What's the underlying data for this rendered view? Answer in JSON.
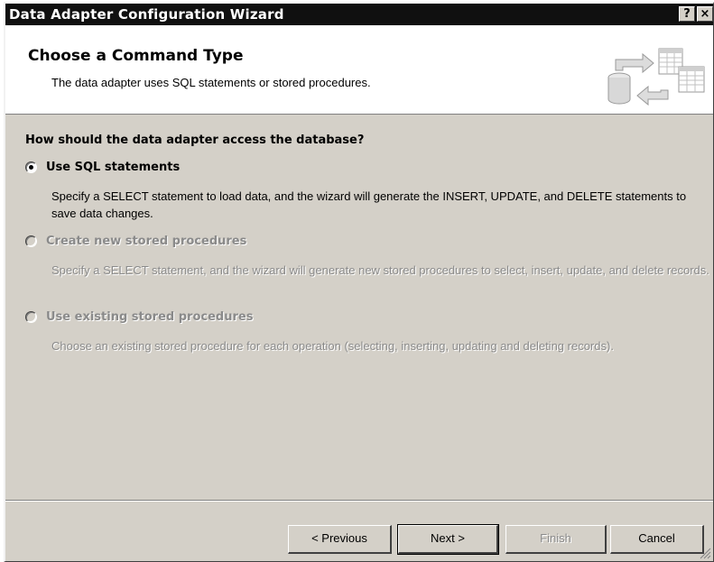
{
  "window": {
    "title": "Data Adapter Configuration Wizard",
    "help_label": "?",
    "close_label": "×"
  },
  "header": {
    "title": "Choose a Command Type",
    "subtitle": "The data adapter uses SQL statements or stored procedures.",
    "icon": "database-to-tables-icon"
  },
  "content": {
    "question": "How should the data adapter access the database?",
    "options": [
      {
        "label": "Use SQL statements",
        "selected": true,
        "enabled": true,
        "description": "Specify a SELECT statement to load data, and the wizard will generate the INSERT, UPDATE, and DELETE statements to save data changes."
      },
      {
        "label": "Create new stored procedures",
        "selected": false,
        "enabled": false,
        "description": "Specify a SELECT statement, and the wizard will generate new stored procedures to select, insert, update, and delete records."
      },
      {
        "label": "Use existing stored procedures",
        "selected": false,
        "enabled": false,
        "description": "Choose an existing stored procedure for each operation (selecting, inserting, updating and deleting records)."
      }
    ]
  },
  "buttons": {
    "previous": "< Previous",
    "next": "Next >",
    "finish": "Finish",
    "cancel": "Cancel"
  }
}
